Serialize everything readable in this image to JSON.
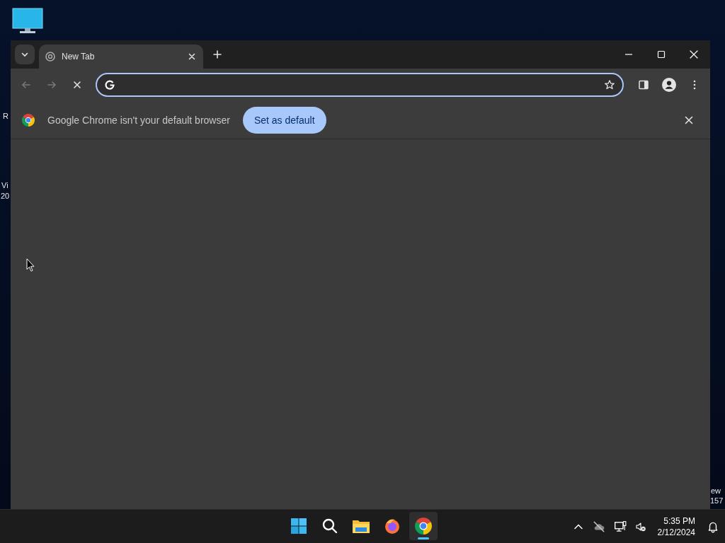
{
  "desktop": {
    "edge_labels": [
      "R",
      "Vi",
      "20",
      "ew",
      "157"
    ]
  },
  "window": {
    "tabs": [
      {
        "label": "New Tab",
        "selected": true
      }
    ],
    "address_bar": {
      "focused": true
    },
    "infobar": {
      "message": "Google Chrome isn't your default browser",
      "button": "Set as default"
    }
  },
  "taskbar": {
    "apps": [
      {
        "kind": "start",
        "selected": false
      },
      {
        "kind": "search",
        "selected": false
      },
      {
        "kind": "files",
        "selected": false
      },
      {
        "kind": "firefox",
        "selected": false
      },
      {
        "kind": "chrome",
        "selected": true
      }
    ],
    "time": "5:35 PM",
    "date": "2/12/2024"
  }
}
